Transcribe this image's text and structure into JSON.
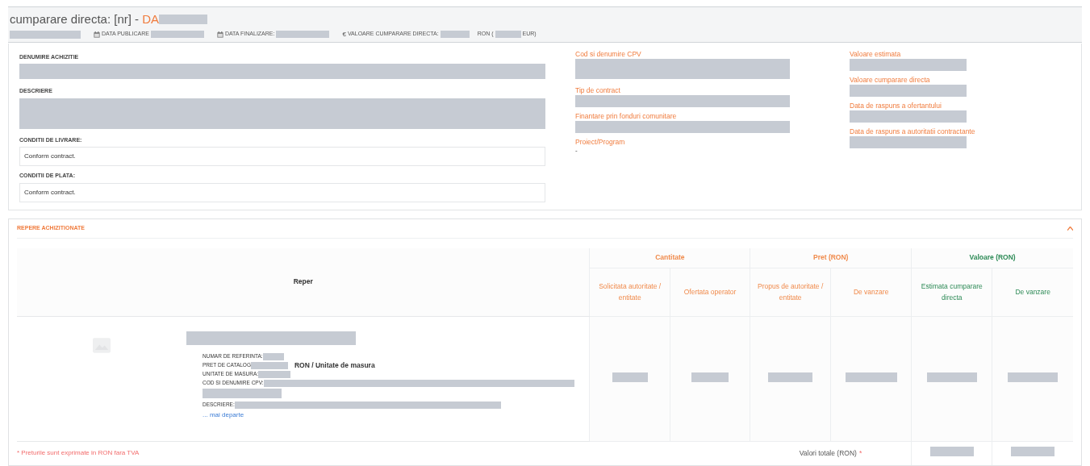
{
  "header": {
    "title": "cumparare directa: [nr] - ",
    "code": "DA",
    "meta": [
      {
        "kind": "calendar",
        "label": "DATA PUBLICARE"
      },
      {
        "kind": "calendar",
        "label": "DATA FINALIZARE:"
      },
      {
        "kind": "currency",
        "symbol": "€",
        "label": "VALOARE CUMPARARE DIRECTA:",
        "unit": "RON (",
        "unit2": "EUR)"
      }
    ]
  },
  "details": {
    "left": [
      {
        "label": "DENUMIRE ACHIZITIE",
        "kind": "redacted"
      },
      {
        "label": "DESCRIERE",
        "kind": "redacted-tall"
      },
      {
        "label": "CONDITII DE LIVRARE:",
        "kind": "box",
        "value": "Conform contract."
      },
      {
        "label": "CONDITII DE PLATA:",
        "kind": "box",
        "value": "Conform contract."
      }
    ],
    "middle": [
      {
        "label": "Cod si denumire CPV",
        "kind": "redacted-tall"
      },
      {
        "label": "Tip de contract",
        "kind": "redacted"
      },
      {
        "label": "Finantare prin fonduri comunitare",
        "kind": "redacted"
      },
      {
        "label": "Proiect/Program",
        "kind": "text",
        "value": "-"
      }
    ],
    "right": [
      {
        "label": "Valoare estimata",
        "kind": "redacted"
      },
      {
        "label": "Valoare cumparare directa",
        "kind": "redacted"
      },
      {
        "label": "Data de raspuns a ofertantului",
        "kind": "redacted"
      },
      {
        "label": "Data de raspuns a autoritatii contractante",
        "kind": "redacted"
      }
    ]
  },
  "items_panel": {
    "title": "REPERE ACHIZITIONATE",
    "expanded": true,
    "table": {
      "reper_heading": "Reper",
      "groups": [
        {
          "label": "Cantitate",
          "color": "#f08a4b",
          "columns": [
            "Solicitata autoritate / entitate",
            "Ofertata operator"
          ]
        },
        {
          "label": "Pret (RON)",
          "color": "#f08a4b",
          "columns": [
            "Propus de autoritate / entitate",
            "De vanzare"
          ]
        },
        {
          "label": "Valoare (RON)",
          "color": "#2e8b57",
          "columns": [
            "Estimata cumparare directa",
            "De vanzare"
          ]
        }
      ],
      "item": {
        "lines": [
          {
            "label": "NUMAR DE REFERINTA:"
          },
          {
            "label": "PRET DE CATALOG",
            "suffix": "RON / Unitate de masura"
          },
          {
            "label": "UNITATE DE MASURA:"
          },
          {
            "label": "COD SI DENUMIRE CPV:"
          },
          {
            "label": "DESCRIERE:"
          }
        ],
        "more_link": "... mai departe"
      },
      "note": "* Preturile sunt exprimate in RON fara TVA",
      "totals_label": "Valori totale (RON)",
      "totals_mark": "*"
    }
  }
}
